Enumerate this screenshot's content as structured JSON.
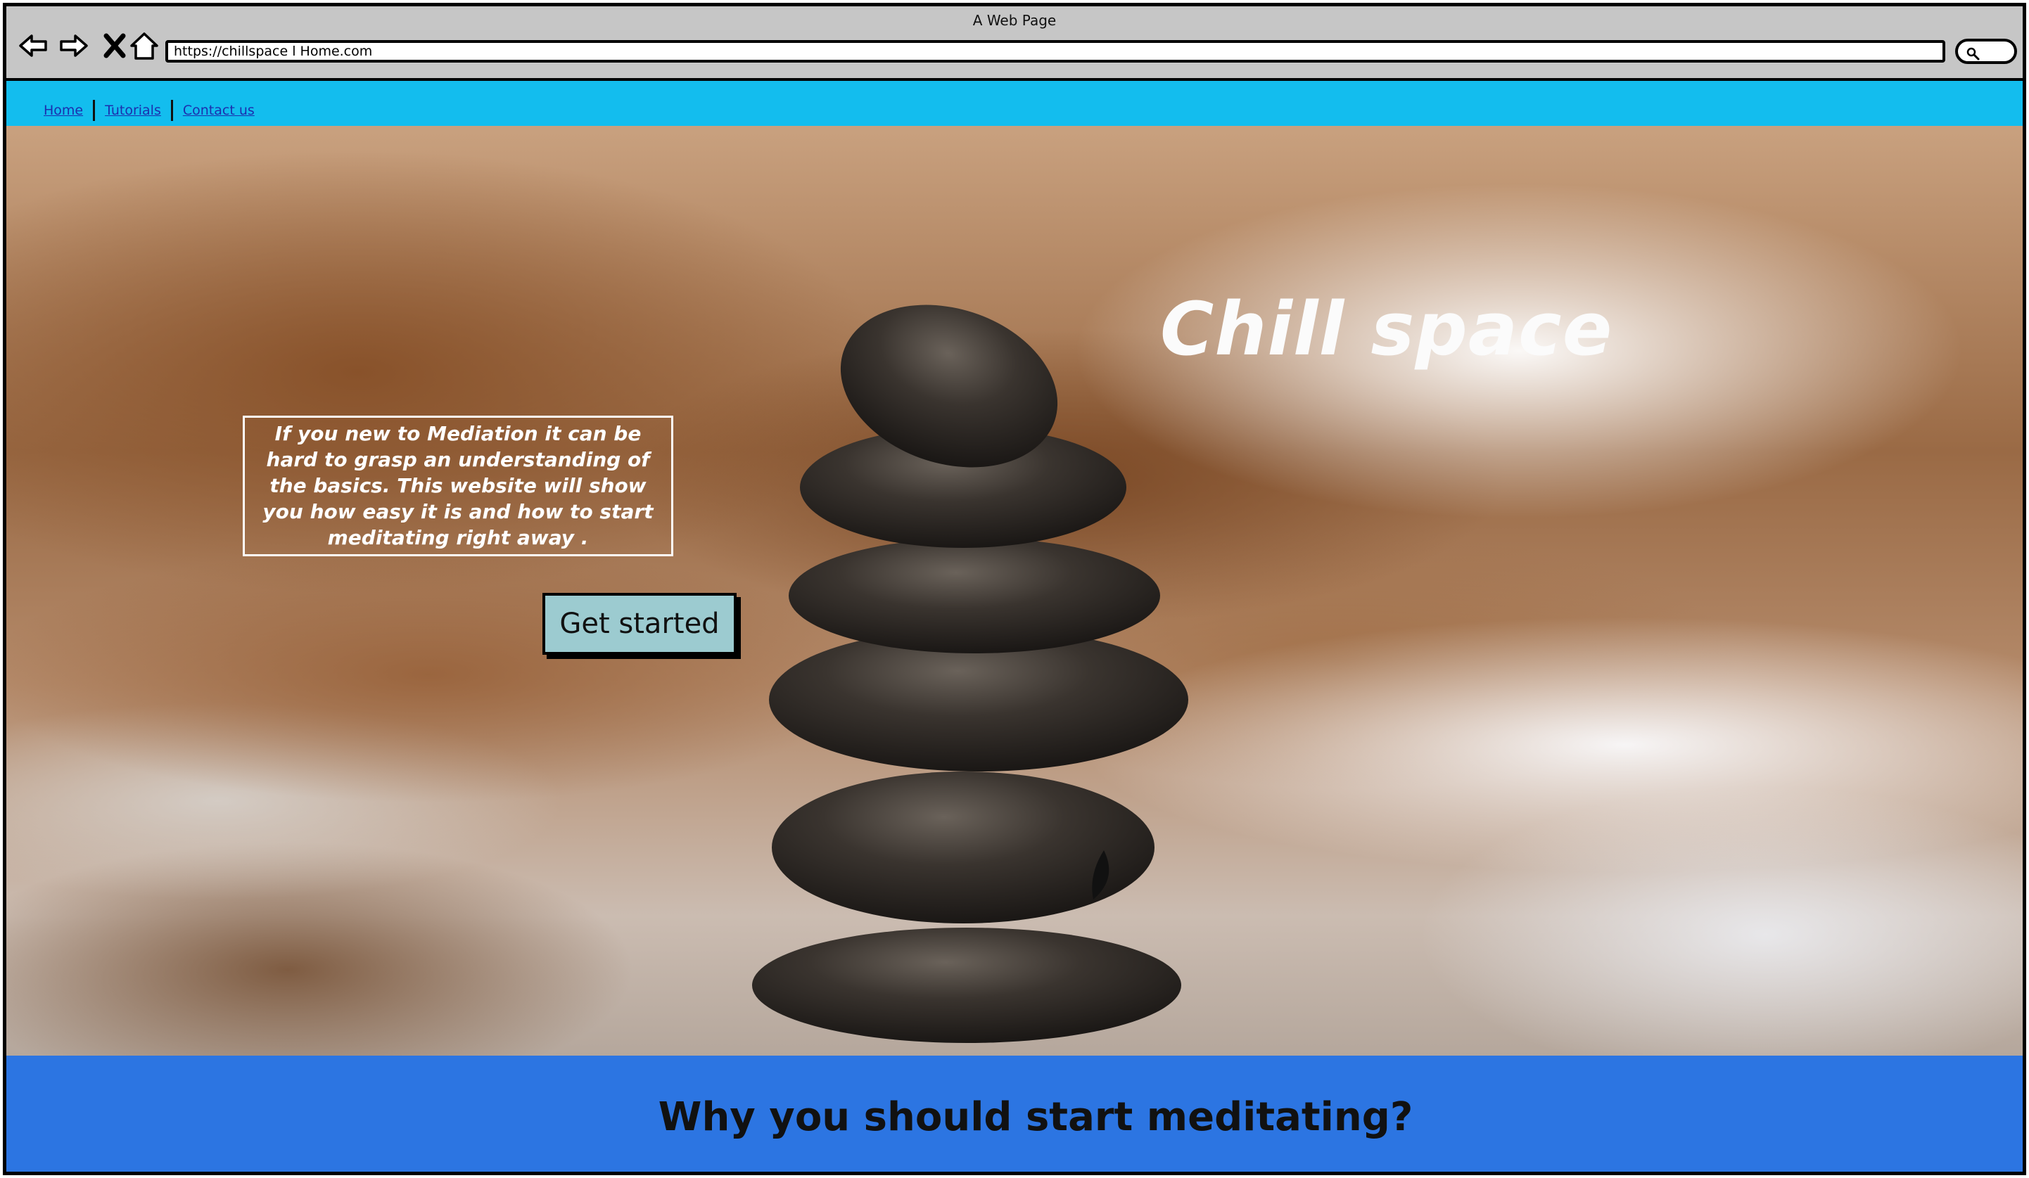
{
  "window": {
    "title": "A Web Page"
  },
  "browser": {
    "url": "https://chillspace l Home.com",
    "icons": {
      "back": "arrow-left-icon",
      "forward": "arrow-right-icon",
      "stop": "close-x-icon",
      "home": "house-icon",
      "search": "magnifier-icon"
    }
  },
  "nav": {
    "items": [
      {
        "label": "Home"
      },
      {
        "label": "Tutorials"
      },
      {
        "label": "Contact us"
      }
    ]
  },
  "hero": {
    "title": "Chill space",
    "intro": "If you new to Mediation it can be hard to grasp an understanding of the basics. This website will show you how easy it is and how to start meditating right away .",
    "cta_label": "Get started"
  },
  "section": {
    "heading": "Why you should start meditating?"
  },
  "colors": {
    "nav_bar": "#13bdee",
    "banner": "#2c75e2",
    "cta": "#9ccbd0",
    "chrome": "#c6c6c6"
  }
}
